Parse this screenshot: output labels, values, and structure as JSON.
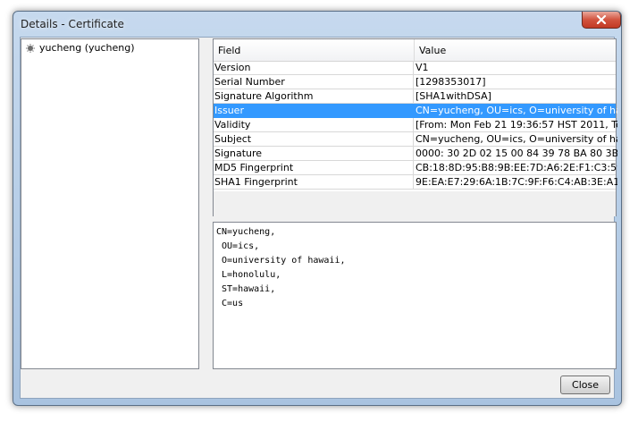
{
  "window": {
    "title": "Details - Certificate"
  },
  "tree": {
    "items": [
      {
        "label": "yucheng (yucheng)"
      }
    ]
  },
  "table": {
    "columns": [
      "Field",
      "Value"
    ],
    "rows": [
      {
        "field": "Version",
        "value": "V1"
      },
      {
        "field": "Serial Number",
        "value": "[1298353017]"
      },
      {
        "field": "Signature Algorithm",
        "value": "[SHA1withDSA]"
      },
      {
        "field": "Issuer",
        "value": "CN=yucheng, OU=ics, O=university of ha..."
      },
      {
        "field": "Validity",
        "value": "[From: Mon Feb 21 19:36:57 HST 2011, To:..."
      },
      {
        "field": "Subject",
        "value": "CN=yucheng, OU=ics, O=university of ha..."
      },
      {
        "field": "Signature",
        "value": "0000: 30 2D 02 15 00 84 39 78   BA 80 3B 7..."
      },
      {
        "field": "MD5 Fingerprint",
        "value": "CB:18:8D:95:B8:9B:EE:7D:A6:2E:F1:C3:59..."
      },
      {
        "field": "SHA1 Fingerprint",
        "value": "9E:EA:E7:29:6A:1B:7C:9F:F6:C4:AB:3E:A1..."
      }
    ],
    "selected_row": "Issuer"
  },
  "detail": {
    "lines": [
      "CN=yucheng,",
      " OU=ics,",
      " O=university of hawaii,",
      " L=honolulu,",
      " ST=hawaii,",
      " C=us"
    ]
  },
  "buttons": {
    "close_label": "Close"
  },
  "colors": {
    "selection": "#3399ff",
    "title_close": "#c23a24"
  },
  "icons": {
    "window_close": "close-icon",
    "tree_node": "certificate-node-icon"
  }
}
